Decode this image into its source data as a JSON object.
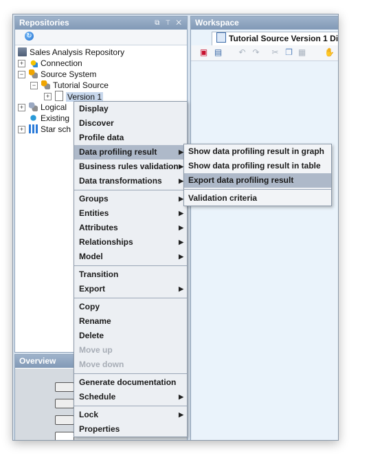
{
  "repositories": {
    "title": "Repositories",
    "controls": "⧉ ⊤ ✕",
    "tree": [
      {
        "label": "Sales Analysis Repository"
      },
      {
        "label": "Connection"
      },
      {
        "label": "Source System"
      },
      {
        "label": "Tutorial Source"
      },
      {
        "label": "Version 1"
      },
      {
        "label": "Logical"
      },
      {
        "label": "Existing"
      },
      {
        "label": "Star sch"
      }
    ]
  },
  "overview": {
    "title": "Overview"
  },
  "workspace": {
    "title": "Workspace",
    "tab_label": "Tutorial Source Version 1 Di"
  },
  "context_menu": {
    "items": [
      {
        "label": "Display"
      },
      {
        "label": "Discover"
      },
      {
        "label": "Profile data"
      },
      {
        "label": "Data profiling result"
      },
      {
        "label": "Business rules validation"
      },
      {
        "label": "Data transformations"
      },
      {
        "label": "Groups"
      },
      {
        "label": "Entities"
      },
      {
        "label": "Attributes"
      },
      {
        "label": "Relationships"
      },
      {
        "label": "Model"
      },
      {
        "label": "Transition"
      },
      {
        "label": "Export"
      },
      {
        "label": "Copy"
      },
      {
        "label": "Rename"
      },
      {
        "label": "Delete"
      },
      {
        "label": "Move up"
      },
      {
        "label": "Move down"
      },
      {
        "label": "Generate documentation"
      },
      {
        "label": "Schedule"
      },
      {
        "label": "Lock"
      },
      {
        "label": "Properties"
      }
    ]
  },
  "submenu": {
    "items": [
      {
        "label": "Show data profiling result in graph"
      },
      {
        "label": "Show data profiling result in table"
      },
      {
        "label": "Export data profiling result"
      },
      {
        "label": "Validation criteria"
      }
    ]
  }
}
